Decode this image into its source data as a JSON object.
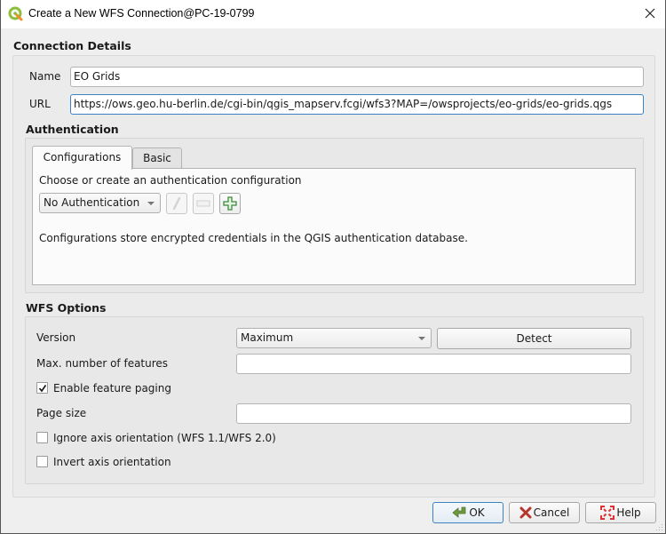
{
  "window": {
    "title": "Create a New WFS Connection@PC-19-0799",
    "app_icon": "qgis-logo-icon",
    "close_icon": "close-icon"
  },
  "connection_details": {
    "group_title": "Connection Details",
    "name_label": "Name",
    "name_value": "EO Grids",
    "url_label": "URL",
    "url_value": "https://ows.geo.hu-berlin.de/cgi-bin/qgis_mapserv.fcgi/wfs3?MAP=/owsprojects/eo-grids/eo-grids.qgs"
  },
  "authentication": {
    "group_title": "Authentication",
    "tabs": [
      {
        "label": "Configurations",
        "active": true
      },
      {
        "label": "Basic",
        "active": false
      }
    ],
    "instruction": "Choose or create an authentication configuration",
    "config_select_value": "No Authentication",
    "tool_buttons": [
      {
        "icon": "edit-pencil-icon",
        "enabled": false
      },
      {
        "icon": "remove-minus-icon",
        "enabled": false
      },
      {
        "icon": "add-plus-icon",
        "enabled": true
      }
    ],
    "info_text": "Configurations store encrypted credentials in the QGIS authentication database."
  },
  "wfs_options": {
    "group_title": "WFS Options",
    "version_label": "Version",
    "version_value": "Maximum",
    "detect_label": "Detect",
    "max_features_label": "Max. number of features",
    "max_features_value": "",
    "enable_paging_label": "Enable feature paging",
    "enable_paging_checked": true,
    "page_size_label": "Page size",
    "page_size_value": "",
    "ignore_axis_label": "Ignore axis orientation (WFS 1.1/WFS 2.0)",
    "ignore_axis_checked": false,
    "invert_axis_label": "Invert axis orientation",
    "invert_axis_checked": false
  },
  "buttons": {
    "ok_label": "OK",
    "cancel_label": "Cancel",
    "help_label": "Help"
  },
  "colors": {
    "focus_accent": "#3b83c4",
    "add_icon_green": "#3a8a3a",
    "cancel_icon_red": "#c0392b",
    "help_icon_red": "#e03030",
    "ok_icon_green": "#5b8a2e"
  }
}
